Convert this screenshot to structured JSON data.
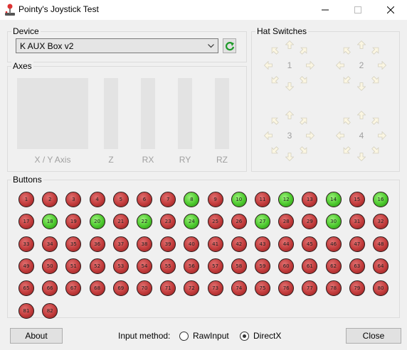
{
  "window": {
    "title": "Pointy's Joystick Test"
  },
  "device": {
    "group_label": "Device",
    "selected": "K AUX Box v2",
    "refresh_icon": "refresh-icon"
  },
  "axes": {
    "group_label": "Axes",
    "labels": [
      "X / Y Axis",
      "Z",
      "RX",
      "RY",
      "RZ"
    ]
  },
  "hats": {
    "group_label": "Hat Switches",
    "items": [
      "1",
      "2",
      "3",
      "4"
    ]
  },
  "buttons": {
    "group_label": "Buttons",
    "on_color": "#4cc92d",
    "off_color": "#c23b3b",
    "pressed": [
      8,
      10,
      12,
      14,
      16,
      18,
      20,
      22,
      24,
      27,
      30
    ],
    "count": 82
  },
  "footer": {
    "about_label": "About",
    "input_method_label": "Input method:",
    "rawinput_label": "RawInput",
    "directx_label": "DirectX",
    "selected_method": "DirectX",
    "close_label": "Close"
  }
}
